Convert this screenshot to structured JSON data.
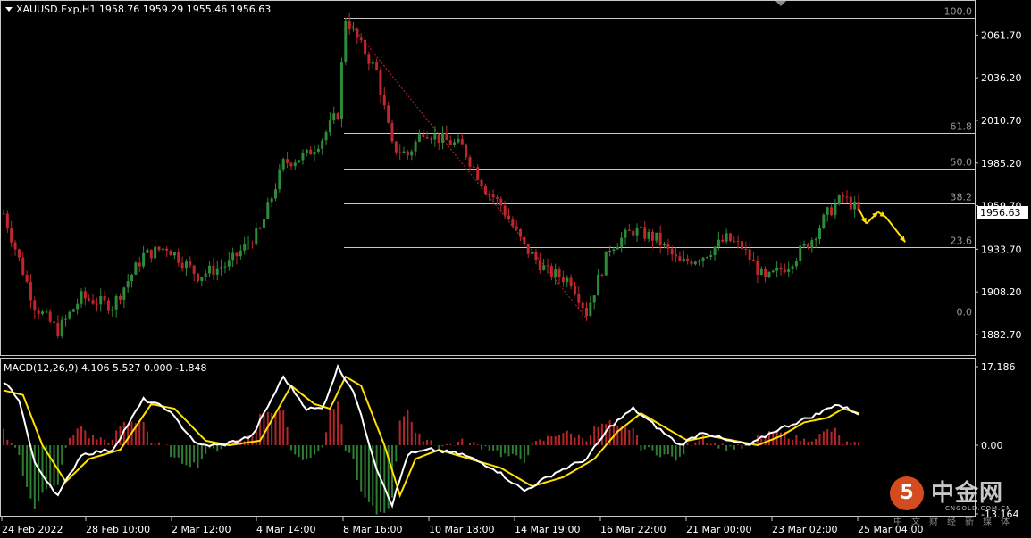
{
  "header": {
    "symbol_line": "XAUUSD.Exp,H1  1958.76 1959.29 1955.46 1956.63",
    "macd_line": "MACD(12,26,9) 4.106 5.527 0.000 -1.848"
  },
  "chart_data": [
    {
      "type": "candlestick",
      "title": "XAUUSD.Exp,H1",
      "ohlc_last": {
        "open": 1958.76,
        "high": 1959.29,
        "low": 1955.46,
        "close": 1956.63
      },
      "current_price_label": "1956.63",
      "y_ticks": [
        "2061.70",
        "2036.20",
        "2010.70",
        "1985.20",
        "1959.70",
        "1933.70",
        "1908.20",
        "1882.70"
      ],
      "x_ticks": [
        "24 Feb 2022",
        "28 Feb 10:00",
        "2 Mar 12:00",
        "4 Mar 14:00",
        "8 Mar 16:00",
        "10 Mar 18:00",
        "14 Mar 19:00",
        "16 Mar 22:00",
        "21 Mar 00:00",
        "23 Mar 02:00",
        "25 Mar 04:00"
      ],
      "ylim": [
        1877,
        2072
      ],
      "colors": {
        "bull": "#2e8b3a",
        "bear": "#c0262c",
        "background": "#000000",
        "grid_line": "#c8c8c8"
      },
      "price_path_keypoints": [
        [
          0,
          1955
        ],
        [
          8,
          1900
        ],
        [
          14,
          1885
        ],
        [
          20,
          1905
        ],
        [
          28,
          1900
        ],
        [
          36,
          1930
        ],
        [
          42,
          1935
        ],
        [
          50,
          1918
        ],
        [
          58,
          1925
        ],
        [
          66,
          1945
        ],
        [
          72,
          1985
        ],
        [
          78,
          1990
        ],
        [
          82,
          2000
        ],
        [
          86,
          2015
        ],
        [
          88,
          2072
        ],
        [
          92,
          2055
        ],
        [
          96,
          2040
        ],
        [
          100,
          1995
        ],
        [
          104,
          1990
        ],
        [
          108,
          2005
        ],
        [
          112,
          2000
        ],
        [
          118,
          1995
        ],
        [
          124,
          1970
        ],
        [
          128,
          1960
        ],
        [
          134,
          1935
        ],
        [
          140,
          1920
        ],
        [
          146,
          1915
        ],
        [
          150,
          1896
        ],
        [
          156,
          1935
        ],
        [
          162,
          1945
        ],
        [
          168,
          1940
        ],
        [
          174,
          1925
        ],
        [
          180,
          1930
        ],
        [
          186,
          1940
        ],
        [
          190,
          1935
        ],
        [
          196,
          1915
        ],
        [
          202,
          1925
        ],
        [
          208,
          1940
        ],
        [
          212,
          1955
        ],
        [
          216,
          1965
        ],
        [
          220,
          1956.63
        ]
      ],
      "fibonacci": {
        "levels": [
          {
            "label": "100.0",
            "price": 2072.0
          },
          {
            "label": "61.8",
            "price": 2003.3
          },
          {
            "label": "50.0",
            "price": 1982.1
          },
          {
            "label": "38.2",
            "price": 1960.9
          },
          {
            "label": "23.6",
            "price": 1934.7
          },
          {
            "label": "0.0",
            "price": 1892.3
          }
        ]
      },
      "trendline": {
        "from": [
          88,
          2072
        ],
        "to": [
          150,
          1892.3
        ],
        "color": "#c0262c",
        "style": "dotted"
      },
      "arrows": {
        "color": "#ffe000",
        "path": [
          [
            220,
            1958
          ],
          [
            222,
            1949
          ],
          [
            225,
            1956
          ],
          [
            227,
            1953
          ],
          [
            232,
            1938
          ]
        ]
      }
    },
    {
      "type": "macd",
      "title": "MACD(12,26,9)",
      "values": {
        "macd": 4.106,
        "signal": 5.527,
        "zero": 0.0,
        "histogram": -1.848
      },
      "y_ticks": [
        "17.186",
        "0.00",
        "-13.164"
      ],
      "ylim": [
        -14.5,
        18
      ],
      "macd_keypoints": [
        [
          0,
          14
        ],
        [
          4,
          10
        ],
        [
          8,
          -4
        ],
        [
          14,
          -11
        ],
        [
          20,
          -2
        ],
        [
          28,
          -1
        ],
        [
          36,
          10
        ],
        [
          42,
          8
        ],
        [
          50,
          0
        ],
        [
          56,
          0
        ],
        [
          64,
          2
        ],
        [
          72,
          15
        ],
        [
          78,
          8
        ],
        [
          82,
          8
        ],
        [
          86,
          17
        ],
        [
          90,
          12
        ],
        [
          96,
          -5
        ],
        [
          100,
          -13
        ],
        [
          104,
          -2
        ],
        [
          110,
          -1
        ],
        [
          118,
          -2
        ],
        [
          126,
          -5
        ],
        [
          134,
          -10
        ],
        [
          142,
          -6
        ],
        [
          150,
          -3
        ],
        [
          156,
          4
        ],
        [
          162,
          8
        ],
        [
          168,
          4
        ],
        [
          174,
          0
        ],
        [
          180,
          3
        ],
        [
          186,
          1
        ],
        [
          192,
          0
        ],
        [
          198,
          3
        ],
        [
          204,
          5
        ],
        [
          210,
          7
        ],
        [
          214,
          9
        ],
        [
          220,
          7
        ]
      ],
      "signal_keypoints": [
        [
          0,
          12
        ],
        [
          5,
          11
        ],
        [
          10,
          0
        ],
        [
          16,
          -8
        ],
        [
          22,
          -3
        ],
        [
          30,
          -1
        ],
        [
          38,
          9
        ],
        [
          44,
          8
        ],
        [
          52,
          1
        ],
        [
          58,
          0
        ],
        [
          66,
          1
        ],
        [
          74,
          13
        ],
        [
          80,
          9
        ],
        [
          84,
          8
        ],
        [
          88,
          15
        ],
        [
          92,
          13
        ],
        [
          98,
          0
        ],
        [
          102,
          -11
        ],
        [
          106,
          -3
        ],
        [
          112,
          -1
        ],
        [
          120,
          -3
        ],
        [
          128,
          -5
        ],
        [
          136,
          -9
        ],
        [
          144,
          -7
        ],
        [
          152,
          -3
        ],
        [
          158,
          3
        ],
        [
          164,
          7
        ],
        [
          170,
          4
        ],
        [
          176,
          1
        ],
        [
          182,
          2
        ],
        [
          188,
          1
        ],
        [
          194,
          0
        ],
        [
          200,
          2
        ],
        [
          206,
          5
        ],
        [
          212,
          6
        ],
        [
          216,
          8
        ],
        [
          220,
          7
        ]
      ],
      "colors": {
        "macd": "#ffffff",
        "signal": "#ffe000",
        "hist_pos": "#b5262b",
        "hist_neg": "#2e7d32"
      }
    }
  ],
  "watermark": {
    "logo_glyph": "5",
    "name": "中金网",
    "site": "CNGOLD.COM.CN",
    "subtitle": "中文财经新媒体"
  }
}
